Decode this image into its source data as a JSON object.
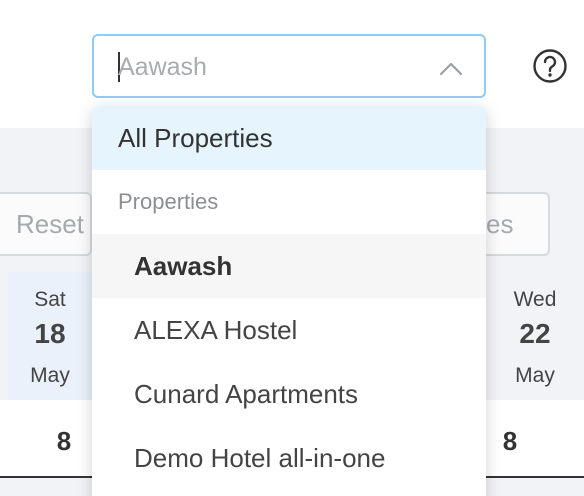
{
  "select": {
    "placeholder": "Aawash",
    "open": true
  },
  "help": {
    "icon": "help-circle-icon"
  },
  "toolbar": {
    "reset_label": "Reset",
    "right_button_label": "es"
  },
  "calendar": {
    "days": [
      {
        "weekday": "Sat",
        "day": "18",
        "month": "May",
        "count": "8"
      },
      {
        "weekday": "Wed",
        "day": "22",
        "month": "May",
        "count": "8"
      }
    ]
  },
  "dropdown": {
    "all_label": "All Properties",
    "group_label": "Properties",
    "options": [
      {
        "label": "Aawash",
        "active": true
      },
      {
        "label": "ALEXA Hostel",
        "active": false
      },
      {
        "label": "Cunard Apartments",
        "active": false
      },
      {
        "label": "Demo Hotel all-in-one",
        "active": false
      }
    ]
  },
  "colors": {
    "focus_border": "#8fcbf3",
    "highlight": "#e6f4fd",
    "selected_column": "#eaf1fb"
  }
}
